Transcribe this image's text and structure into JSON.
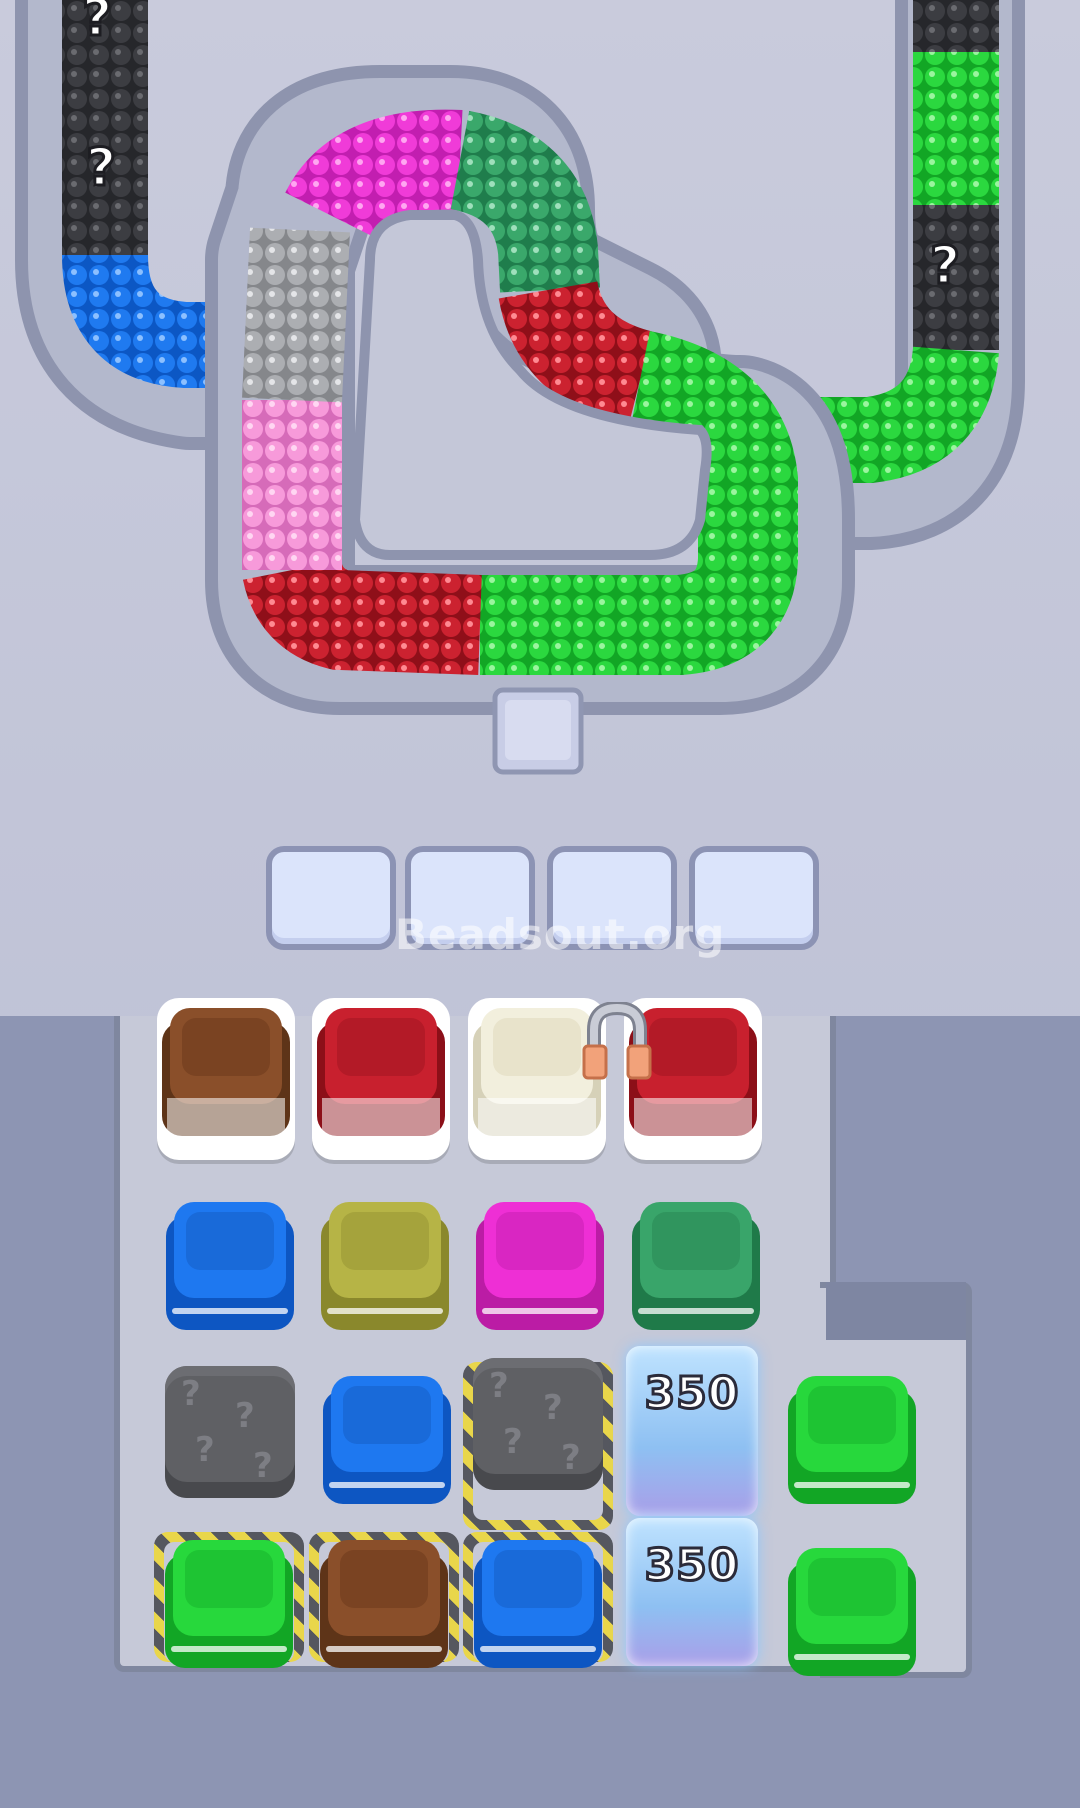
{
  "track": {
    "hidden_marker": "?",
    "exit": "exit-chute"
  },
  "slots": [
    "",
    "",
    "",
    ""
  ],
  "watermark": "Beadsout.org",
  "colors": {
    "brown": "#8a4f2a",
    "red": "#c8202e",
    "cream": "#f2efdd",
    "blue": "#1e78f0",
    "olive": "#b6b446",
    "magenta": "#ee2fd5",
    "teal": "#39a56a",
    "green": "#27d83c",
    "pink": "#f58fd8",
    "grey": "#a9acb0",
    "black": "#2e2f33"
  },
  "board": {
    "top_row": [
      "brown",
      "red",
      "cream",
      "red"
    ],
    "row2": [
      "blue",
      "olive",
      "magenta",
      "teal"
    ],
    "row3": [
      "stone",
      "blue",
      "stone-hazard",
      "ice",
      "green"
    ],
    "row4": [
      "green-hazard",
      "brown-hazard",
      "blue-hazard",
      "ice",
      "green"
    ],
    "ice_counts": [
      "350",
      "350"
    ]
  },
  "magnet_tool": "magnet-icon"
}
